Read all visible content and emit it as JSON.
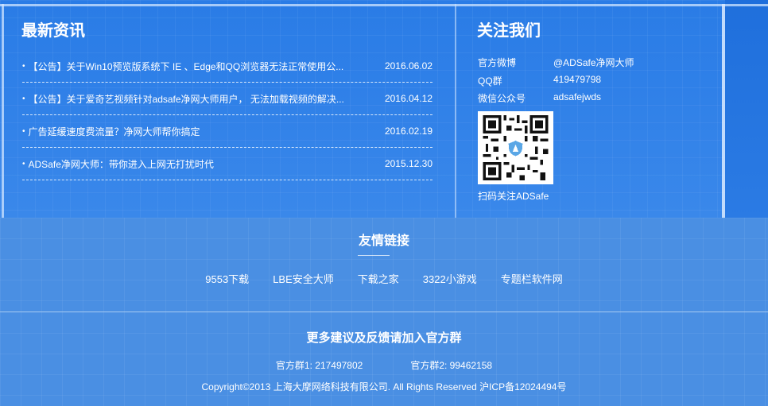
{
  "news": {
    "title": "最新资讯",
    "items": [
      {
        "text": "【公告】关于Win10预览版系统下 IE 、Edge和QQ浏览器无法正常使用公...",
        "date": "2016.06.02"
      },
      {
        "text": "【公告】关于爱奇艺视频针对adsafe净网大师用户， 无法加载视频的解决...",
        "date": "2016.04.12"
      },
      {
        "text": "广告延缓速度费流量？净网大师帮你搞定",
        "date": "2016.02.19"
      },
      {
        "text": "ADSafe净网大师：带你进入上网无打扰时代",
        "date": "2015.12.30"
      }
    ]
  },
  "follow": {
    "title": "关注我们",
    "rows": [
      {
        "label": "官方微博",
        "value": "@ADSafe净网大师"
      },
      {
        "label": "QQ群",
        "value": "419479798"
      },
      {
        "label": "微信公众号",
        "value": "adsafejwds"
      }
    ],
    "qr_caption": "扫码关注ADSafe"
  },
  "links": {
    "title": "友情链接",
    "items": [
      "9553下载",
      "LBE安全大师",
      "下载之家",
      "3322小游戏",
      "专题栏软件网"
    ]
  },
  "footer": {
    "feedback": "更多建议及反馈请加入官方群",
    "group1": "官方群1: 217497802",
    "group2": "官方群2: 99462158",
    "copyright": "Copyright©2013 上海大摩网络科技有限公司. All Rights Reserved 沪ICP备12024494号"
  }
}
